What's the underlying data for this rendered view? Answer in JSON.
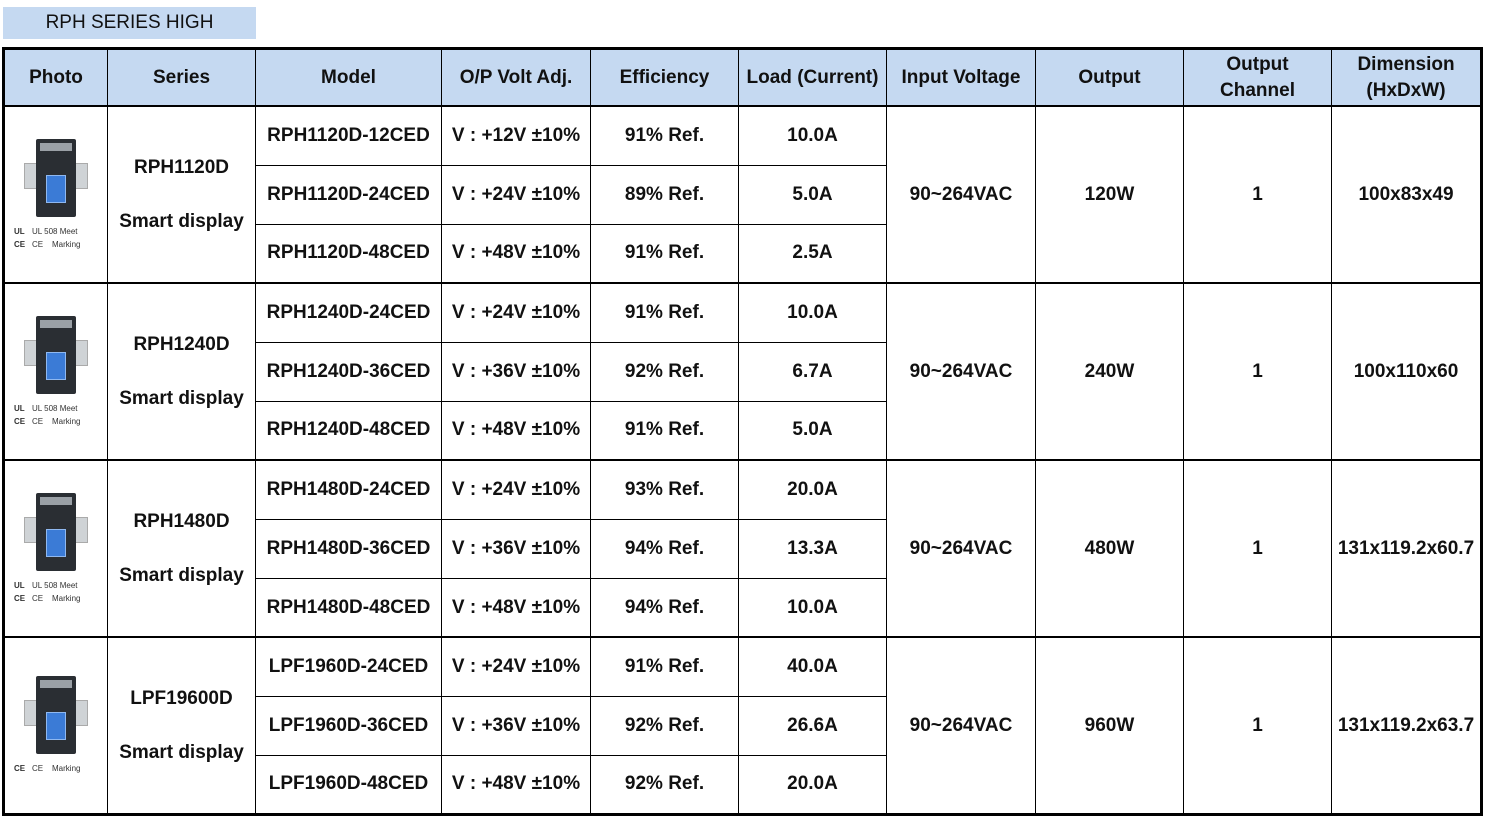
{
  "title": "RPH SERIES HIGH",
  "headers": {
    "photo": "Photo",
    "series": "Series",
    "model": "Model",
    "op_volt": "O/P Volt Adj.",
    "efficiency": "Efficiency",
    "load": "Load (Current)",
    "input_voltage": "Input Voltage",
    "output": "Output",
    "output_channel_1": "Output",
    "output_channel_2": "Channel",
    "dimension_1": "Dimension",
    "dimension_2": "(HxDxW)"
  },
  "marks": {
    "ul_symbol": "UL",
    "ul_text": "UL 508 Meet",
    "ce_symbol": "CE",
    "ce_text": "CE",
    "marking_text": "Marking"
  },
  "groups": [
    {
      "series": "RPH1120D",
      "series_sub": "Smart display",
      "input_voltage": "90~264VAC",
      "output": "120W",
      "channel": "1",
      "dimension": "100x83x49",
      "rows": [
        {
          "model": "RPH1120D-12CED",
          "volt": "V : +12V ±10%",
          "eff": "91% Ref.",
          "load": "10.0A"
        },
        {
          "model": "RPH1120D-24CED",
          "volt": "V : +24V ±10%",
          "eff": "89% Ref.",
          "load": "5.0A"
        },
        {
          "model": "RPH1120D-48CED",
          "volt": "V : +48V ±10%",
          "eff": "91% Ref.",
          "load": "2.5A"
        }
      ]
    },
    {
      "series": "RPH1240D",
      "series_sub": "Smart display",
      "input_voltage": "90~264VAC",
      "output": "240W",
      "channel": "1",
      "dimension": "100x110x60",
      "rows": [
        {
          "model": "RPH1240D-24CED",
          "volt": "V : +24V ±10%",
          "eff": "91% Ref.",
          "load": "10.0A"
        },
        {
          "model": "RPH1240D-36CED",
          "volt": "V : +36V ±10%",
          "eff": "92% Ref.",
          "load": "6.7A"
        },
        {
          "model": "RPH1240D-48CED",
          "volt": "V : +48V ±10%",
          "eff": "91% Ref.",
          "load": "5.0A"
        }
      ]
    },
    {
      "series": "RPH1480D",
      "series_sub": "Smart display",
      "input_voltage": "90~264VAC",
      "output": "480W",
      "channel": "1",
      "dimension": "131x119.2x60.7",
      "rows": [
        {
          "model": "RPH1480D-24CED",
          "volt": "V : +24V ±10%",
          "eff": "93% Ref.",
          "load": "20.0A"
        },
        {
          "model": "RPH1480D-36CED",
          "volt": "V : +36V ±10%",
          "eff": "94% Ref.",
          "load": "13.3A"
        },
        {
          "model": "RPH1480D-48CED",
          "volt": "V : +48V ±10%",
          "eff": "94% Ref.",
          "load": "10.0A"
        }
      ]
    },
    {
      "series": "LPF19600D",
      "series_sub": "Smart display",
      "input_voltage": "90~264VAC",
      "output": "960W",
      "channel": "1",
      "dimension": "131x119.2x63.7",
      "rows": [
        {
          "model": "LPF1960D-24CED",
          "volt": "V : +24V ±10%",
          "eff": "91% Ref.",
          "load": "40.0A"
        },
        {
          "model": "LPF1960D-36CED",
          "volt": "V : +36V ±10%",
          "eff": "92% Ref.",
          "load": "26.6A"
        },
        {
          "model": "LPF1960D-48CED",
          "volt": "V : +48V ±10%",
          "eff": "92% Ref.",
          "load": "20.0A"
        }
      ]
    }
  ]
}
